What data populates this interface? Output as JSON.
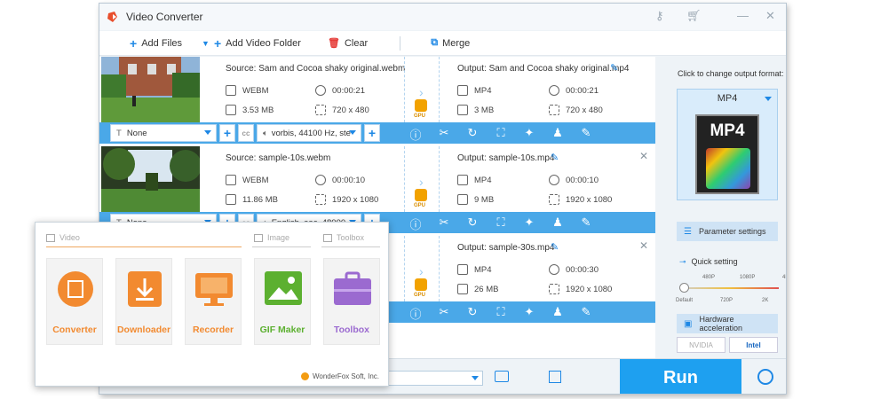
{
  "app": {
    "title": "Video Converter"
  },
  "toolbar": {
    "add_files": "Add Files",
    "add_folder": "Add Video Folder",
    "clear": "Clear",
    "merge": "Merge"
  },
  "items": [
    {
      "source": "Source: Sam and Cocoa shaky original.webm",
      "output": "Output: Sam and Cocoa shaky original.mp4",
      "src_format": "WEBM",
      "src_duration": "00:00:21",
      "src_size": "3.53 MB",
      "src_res": "720 x 480",
      "out_format": "MP4",
      "out_duration": "00:00:21",
      "out_size": "3 MB",
      "out_res": "720 x 480",
      "subtitle": "None",
      "audio": "vorbis, 44100 Hz, ste"
    },
    {
      "source": "Source: sample-10s.webm",
      "output": "Output: sample-10s.mp4",
      "src_format": "WEBM",
      "src_duration": "00:00:10",
      "src_size": "11.86 MB",
      "src_res": "1920 x 1080",
      "out_format": "MP4",
      "out_duration": "00:00:10",
      "out_size": "9 MB",
      "out_res": "1920 x 1080",
      "subtitle": "None",
      "audio": "English, aac, 48000"
    },
    {
      "output": "Output: sample-30s.mp4",
      "out_format": "MP4",
      "out_duration": "00:00:30",
      "out_size": "26 MB",
      "out_res": "1920 x 1080"
    }
  ],
  "gpu_label": "GPU",
  "right_panel": {
    "click_label": "Click to change output format:",
    "format": "MP4",
    "format_icon_text": "MP4",
    "param_settings": "Parameter settings",
    "quick_setting": "Quick setting",
    "quality_top": [
      "480P",
      "1080P",
      "4K"
    ],
    "quality_bottom": [
      "Default",
      "720P",
      "2K"
    ],
    "quality_level": 0,
    "hw_accel": "Hardware acceleration",
    "nvidia": "NVIDIA",
    "intel": "Intel"
  },
  "footer": {
    "run": "Run"
  },
  "overlay": {
    "sections": {
      "video": "Video",
      "image": "Image",
      "toolbox": "Toolbox"
    },
    "tiles": [
      {
        "label": "Converter",
        "color": "#f28a30"
      },
      {
        "label": "Downloader",
        "color": "#f28a30"
      },
      {
        "label": "Recorder",
        "color": "#f28a30"
      },
      {
        "label": "GIF Maker",
        "color": "#5cb030"
      },
      {
        "label": "Toolbox",
        "color": "#9b6ad0"
      }
    ],
    "brand": "WonderFox Soft, Inc."
  }
}
